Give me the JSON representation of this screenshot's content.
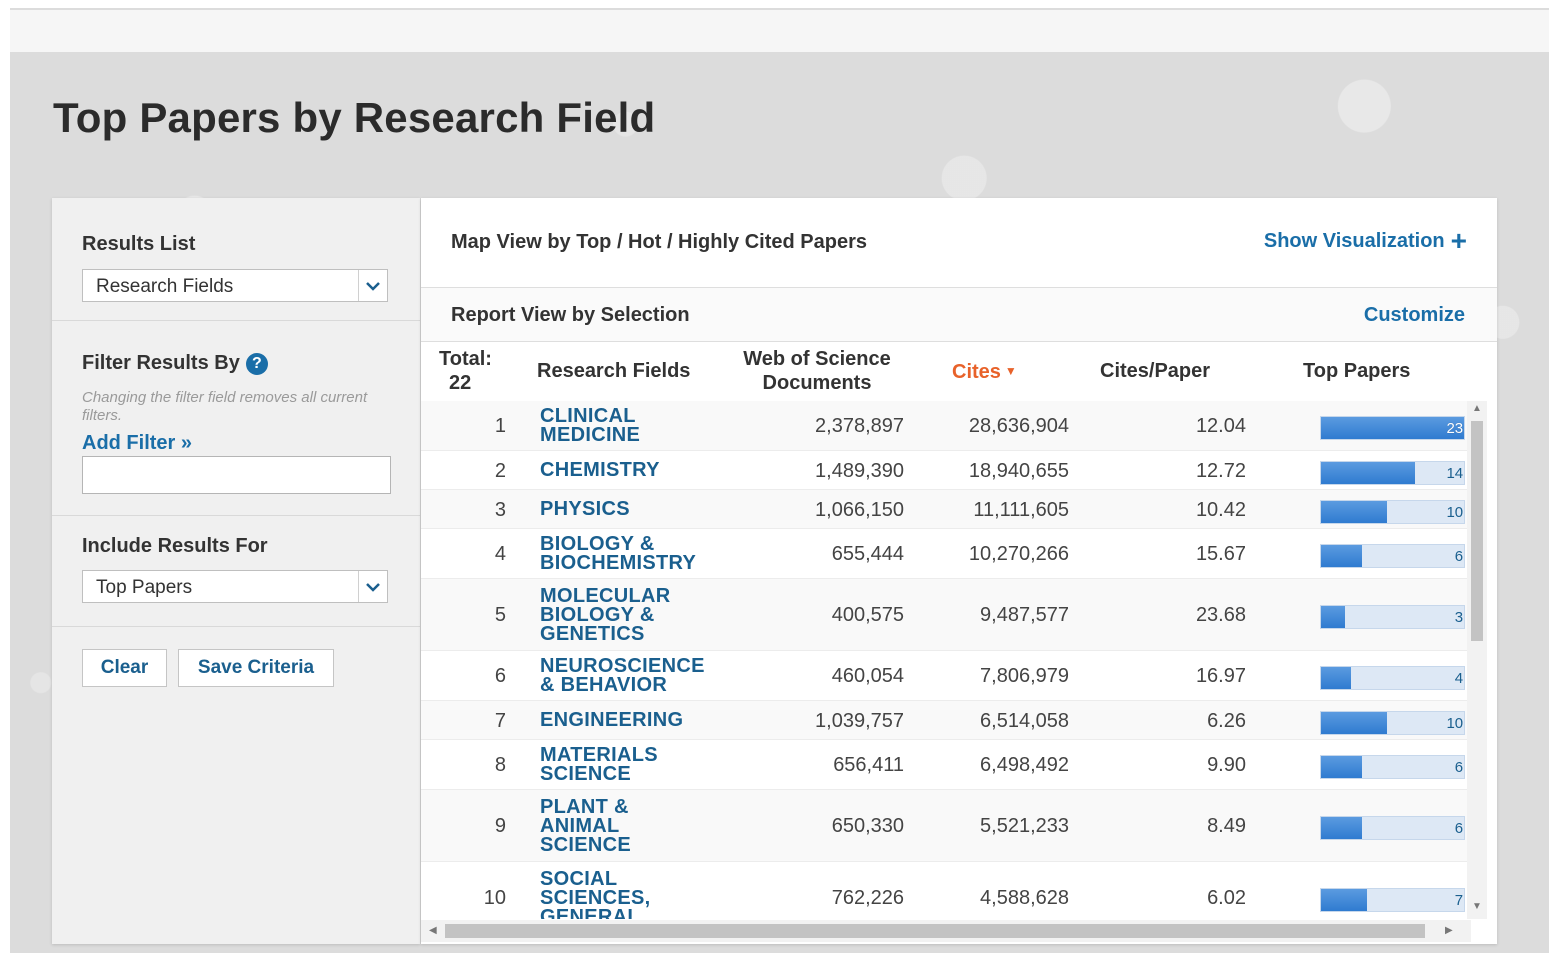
{
  "page": {
    "title": "Top Papers by Research Field"
  },
  "sidebar": {
    "results_list": {
      "label": "Results List",
      "selected": "Research Fields"
    },
    "filter": {
      "label": "Filter Results By",
      "help_icon": "?",
      "note": "Changing the filter field removes all current filters.",
      "add_filter": "Add Filter »",
      "input_value": ""
    },
    "include": {
      "label": "Include Results For",
      "selected": "Top Papers"
    },
    "buttons": {
      "clear": "Clear",
      "save": "Save Criteria"
    }
  },
  "main": {
    "map_view": "Map View by Top / Hot / Highly Cited Papers",
    "show_visualization": "Show Visualization",
    "plus_icon": "+",
    "report_view": "Report View by Selection",
    "customize": "Customize",
    "columns": {
      "total_label": "Total:",
      "total_count": "22",
      "field": "Research Fields",
      "docs_line1": "Web of Science",
      "docs_line2": "Documents",
      "cites": "Cites",
      "cites_per_paper": "Cites/Paper",
      "top_papers": "Top Papers"
    },
    "accent_color": "#e8622a",
    "link_color": "#1a6ea8",
    "rows": [
      {
        "rank": "1",
        "field": [
          "CLINICAL",
          "MEDICINE"
        ],
        "docs": "2,378,897",
        "cites": "28,636,904",
        "cpp": "12.04",
        "top_label": "23,35",
        "top_fraction": 1.0
      },
      {
        "rank": "2",
        "field": [
          "CHEMISTRY"
        ],
        "docs": "1,489,390",
        "cites": "18,940,655",
        "cpp": "12.72",
        "top_label": "14,60",
        "top_fraction": 0.66
      },
      {
        "rank": "3",
        "field": [
          "PHYSICS"
        ],
        "docs": "1,066,150",
        "cites": "11,111,605",
        "cpp": "10.42",
        "top_label": "10,39",
        "top_fraction": 0.46
      },
      {
        "rank": "4",
        "field": [
          "BIOLOGY &",
          "BIOCHEMISTRY"
        ],
        "docs": "655,444",
        "cites": "10,270,266",
        "cpp": "15.67",
        "top_label": "6,54",
        "top_fraction": 0.29
      },
      {
        "rank": "5",
        "field": [
          "MOLECULAR",
          "BIOLOGY &",
          "GENETICS"
        ],
        "docs": "400,575",
        "cites": "9,487,577",
        "cpp": "23.68",
        "top_label": "3,93",
        "top_fraction": 0.17
      },
      {
        "rank": "6",
        "field": [
          "NEUROSCIENCE",
          "& BEHAVIOR"
        ],
        "docs": "460,054",
        "cites": "7,806,979",
        "cpp": "16.97",
        "top_label": "4,54",
        "top_fraction": 0.21
      },
      {
        "rank": "7",
        "field": [
          "ENGINEERING"
        ],
        "docs": "1,039,757",
        "cites": "6,514,058",
        "cpp": "6.26",
        "top_label": "10,33",
        "top_fraction": 0.46
      },
      {
        "rank": "8",
        "field": [
          "MATERIALS",
          "SCIENCE"
        ],
        "docs": "656,411",
        "cites": "6,498,492",
        "cpp": "9.90",
        "top_label": "6,43",
        "top_fraction": 0.29
      },
      {
        "rank": "9",
        "field": [
          "PLANT &",
          "ANIMAL",
          "SCIENCE"
        ],
        "docs": "650,330",
        "cites": "5,521,233",
        "cpp": "8.49",
        "top_label": "6,51",
        "top_fraction": 0.29
      },
      {
        "rank": "10",
        "field": [
          "SOCIAL",
          "SCIENCES,",
          "GENERAL"
        ],
        "docs": "762,226",
        "cites": "4,588,628",
        "cpp": "6.02",
        "top_label": "7,35",
        "top_fraction": 0.32
      }
    ]
  }
}
